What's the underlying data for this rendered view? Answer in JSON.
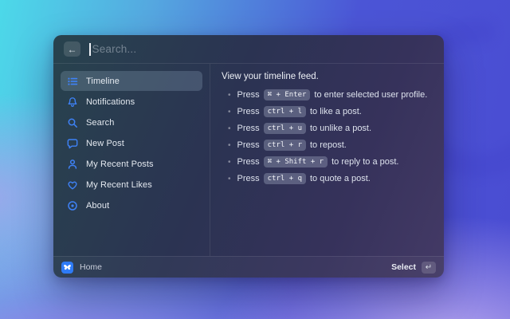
{
  "header": {
    "back_label": "←",
    "search": {
      "placeholder": "Search..."
    }
  },
  "sidebar": {
    "items": [
      {
        "label": "Timeline",
        "icon": "list-icon",
        "selected": true
      },
      {
        "label": "Notifications",
        "icon": "bell-icon",
        "selected": false
      },
      {
        "label": "Search",
        "icon": "search-icon",
        "selected": false
      },
      {
        "label": "New Post",
        "icon": "chat-bubble-icon",
        "selected": false
      },
      {
        "label": "My Recent Posts",
        "icon": "person-icon",
        "selected": false
      },
      {
        "label": "My Recent Likes",
        "icon": "heart-icon",
        "selected": false
      },
      {
        "label": "About",
        "icon": "info-circle-icon",
        "selected": false
      }
    ]
  },
  "detail": {
    "title": "View your timeline feed.",
    "shortcuts": [
      {
        "prefix": "Press",
        "keys": "⌘ + Enter",
        "suffix": "to enter selected user profile."
      },
      {
        "prefix": "Press",
        "keys": "ctrl + l",
        "suffix": "to like a post."
      },
      {
        "prefix": "Press",
        "keys": "ctrl + u",
        "suffix": "to unlike a post."
      },
      {
        "prefix": "Press",
        "keys": "ctrl + r",
        "suffix": "to repost."
      },
      {
        "prefix": "Press",
        "keys": "⌘ + Shift + r",
        "suffix": "to reply to a post."
      },
      {
        "prefix": "Press",
        "keys": "ctrl + q",
        "suffix": "to quote a post."
      }
    ]
  },
  "footer": {
    "app_label": "Home",
    "app_icon": "bluesky-butterfly-icon",
    "select_label": "Select",
    "select_key": "↵"
  },
  "colors": {
    "icon_accent": "#3E82F7",
    "app_icon_bg": "#2E7BF6",
    "bg_top_left": "#4CD9E9",
    "bg_top_right": "#4A4CD2",
    "bg_bottom": "#B0A0EC"
  }
}
